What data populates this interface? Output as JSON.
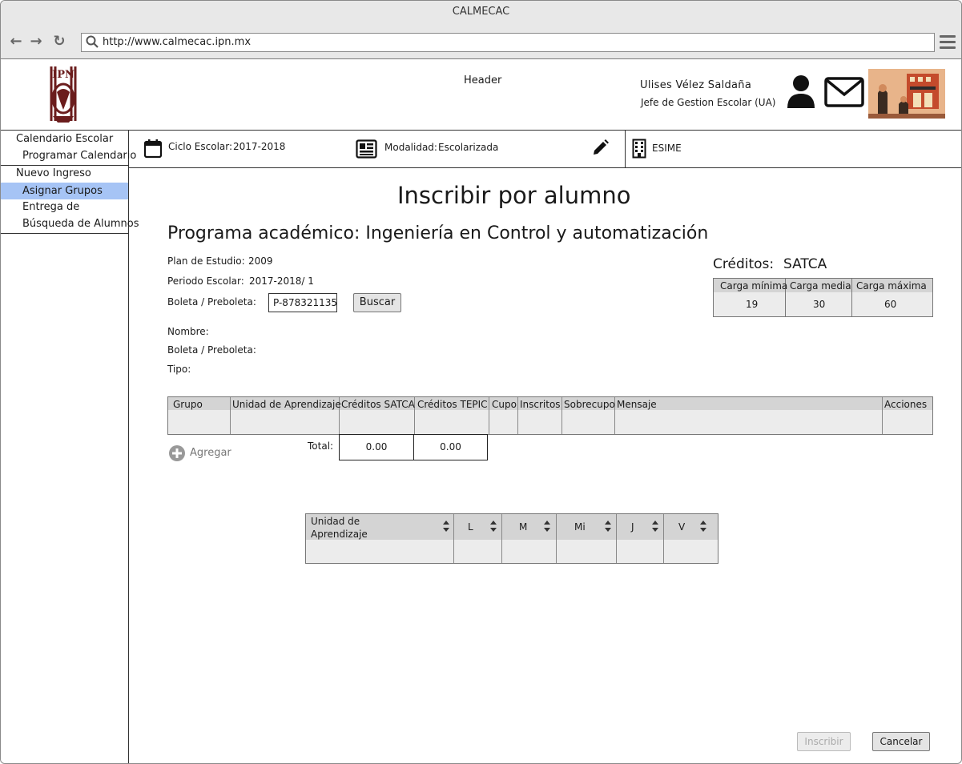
{
  "browser": {
    "window_title": "CALMECAC",
    "url": "http://www.calmecac.ipn.mx"
  },
  "header": {
    "label": "Header",
    "user_name": "Ulises Vélez Saldaña",
    "user_role": "Jefe de Gestion Escolar (UA)"
  },
  "sidebar": {
    "items": [
      {
        "label": "Calendario Escolar"
      },
      {
        "label": "Programar Calendario"
      },
      {
        "label": "Nuevo Ingreso"
      },
      {
        "label": "Asignar Grupos"
      },
      {
        "label": "Entrega de"
      },
      {
        "label": "Búsqueda de Alumnos"
      }
    ]
  },
  "infobar": {
    "ciclo_label": "Ciclo Escolar:",
    "ciclo_value": "2017-2018",
    "modalidad_label": "Modalidad:",
    "modalidad_value": "Escolarizada",
    "school": "ESIME"
  },
  "main": {
    "title": "Inscribir por alumno",
    "program": "Programa académico: Ingeniería en Control y automatización",
    "plan_label": "Plan de Estudio:",
    "plan_value": "2009",
    "periodo_label": "Periodo Escolar:",
    "periodo_value": "2017-2018/ 1",
    "boleta_label": "Boleta / Preboleta:",
    "boleta_value": "P-878321135",
    "buscar": "Buscar",
    "nombre_label": "Nombre:",
    "boleta2_label": "Boleta / Preboleta:",
    "tipo_label": "Tipo:",
    "agregar": "Agregar",
    "total_label": "Total:",
    "total_satca": "0.00",
    "total_tepic": "0.00",
    "inscribir": "Inscribir",
    "cancelar": "Cancelar"
  },
  "credits": {
    "label": "Créditos:",
    "system": "SATCA",
    "headers": [
      "Carga mínima",
      "Carga media",
      "Carga máxima"
    ],
    "values": [
      "19",
      "30",
      "60"
    ]
  },
  "groups_table": {
    "headers": [
      "Grupo",
      "Unidad de Aprendizaje",
      "Créditos SATCA",
      "Créditos TEPIC",
      "Cupo",
      "Inscritos",
      "Sobrecupo",
      "Mensaje",
      "Acciones"
    ]
  },
  "schedule_table": {
    "headers": [
      "Unidad de Aprendizaje",
      "L",
      "M",
      "Mi",
      "J",
      "V"
    ]
  }
}
